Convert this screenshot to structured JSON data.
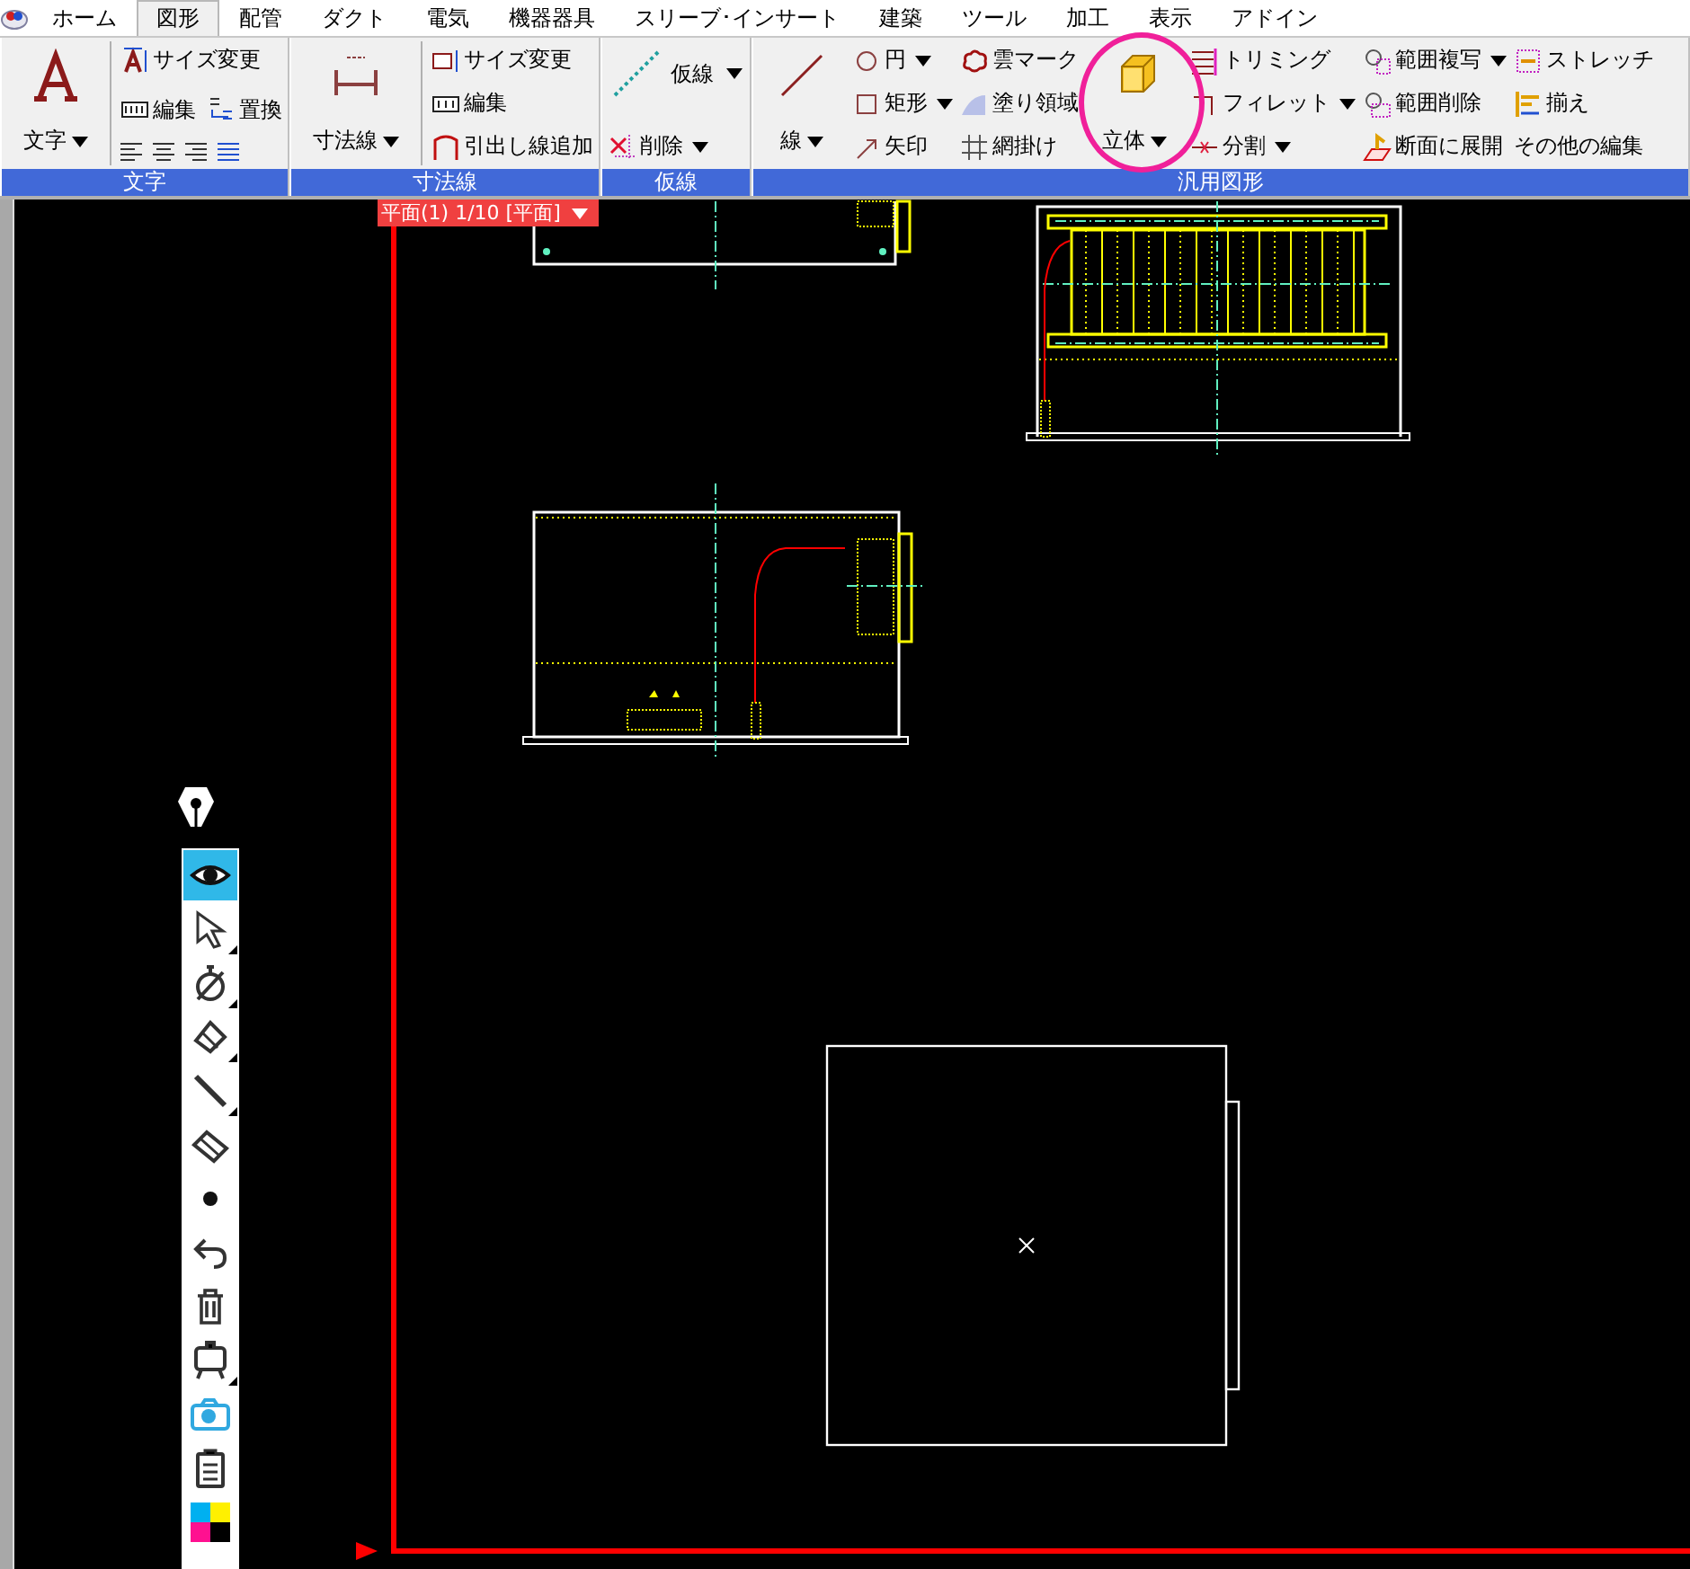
{
  "menu_tabs": [
    {
      "label": "ホーム",
      "selected": false
    },
    {
      "label": "図形",
      "selected": true
    },
    {
      "label": "配管",
      "selected": false
    },
    {
      "label": "ダクト",
      "selected": false
    },
    {
      "label": "電気",
      "selected": false
    },
    {
      "label": "機器器具",
      "selected": false
    },
    {
      "label": "スリーブ･インサート",
      "selected": false
    },
    {
      "label": "建築",
      "selected": false
    },
    {
      "label": "ツール",
      "selected": false
    },
    {
      "label": "加工",
      "selected": false
    },
    {
      "label": "表示",
      "selected": false
    },
    {
      "label": "アドイン",
      "selected": false
    }
  ],
  "ribbon_groups": [
    {
      "title": "文字",
      "columns": [
        [
          [
            {
              "kind": "large",
              "label": "文字",
              "dropdown": true
            }
          ]
        ],
        [
          [
            {
              "kind": "small",
              "label": "サイズ変更",
              "dropdown": false
            }
          ],
          [
            {
              "kind": "small",
              "label": "編集",
              "dropdown": false
            },
            {
              "kind": "small",
              "label": "置換",
              "dropdown": false
            }
          ],
          [
            {
              "kind": "align"
            }
          ]
        ]
      ]
    },
    {
      "title": "寸法線",
      "columns": [
        [
          [
            {
              "kind": "large",
              "label": "寸法線",
              "dropdown": true
            }
          ]
        ],
        [
          [
            {
              "kind": "small",
              "label": "サイズ変更",
              "dropdown": false
            }
          ],
          [
            {
              "kind": "small",
              "label": "編集",
              "dropdown": false
            }
          ],
          [
            {
              "kind": "small",
              "label": "引出し線追加",
              "dropdown": false
            }
          ]
        ]
      ]
    },
    {
      "title": "仮線",
      "columns": [
        [
          [
            {
              "kind": "wide",
              "label": "仮線",
              "dropdown": true
            }
          ],
          [
            {
              "kind": "small",
              "label": "削除",
              "dropdown": true
            }
          ]
        ]
      ]
    },
    {
      "title": "汎用図形",
      "columns": [
        [
          [
            {
              "kind": "large",
              "label": "線",
              "dropdown": true
            }
          ]
        ],
        [
          [
            {
              "kind": "small",
              "label": "円",
              "dropdown": true
            }
          ],
          [
            {
              "kind": "small",
              "label": "矩形",
              "dropdown": true
            }
          ],
          [
            {
              "kind": "small",
              "label": "矢印",
              "dropdown": false
            }
          ]
        ],
        [
          [
            {
              "kind": "small",
              "label": "雲マーク",
              "dropdown": false
            }
          ],
          [
            {
              "kind": "small",
              "label": "塗り領域",
              "dropdown": false
            }
          ],
          [
            {
              "kind": "small",
              "label": "網掛け",
              "dropdown": false
            }
          ]
        ],
        [
          [
            {
              "kind": "large",
              "label": "立体",
              "dropdown": true,
              "highlighted": true
            }
          ]
        ],
        [
          [
            {
              "kind": "small",
              "label": "トリミング",
              "dropdown": false
            }
          ],
          [
            {
              "kind": "small",
              "label": "フィレット",
              "dropdown": true
            }
          ],
          [
            {
              "kind": "small",
              "label": "分割",
              "dropdown": true
            }
          ]
        ],
        [
          [
            {
              "kind": "small",
              "label": "範囲複写",
              "dropdown": true
            }
          ],
          [
            {
              "kind": "small",
              "label": "範囲削除",
              "dropdown": false
            }
          ],
          [
            {
              "kind": "small",
              "label": "断面に展開",
              "dropdown": false
            }
          ]
        ],
        [
          [
            {
              "kind": "small",
              "label": "ストレッチ",
              "dropdown": false
            }
          ],
          [
            {
              "kind": "small",
              "label": "揃え",
              "dropdown": false
            }
          ],
          [
            {
              "kind": "text",
              "label": "その他の編集",
              "dropdown": false
            }
          ]
        ]
      ]
    }
  ],
  "view_tab": {
    "label": "平面(1) 1/10 [平面]"
  },
  "pen_tools": [
    {
      "kind": "eye",
      "selected": true,
      "submenu": false
    },
    {
      "kind": "pointer",
      "selected": false,
      "submenu": true
    },
    {
      "kind": "timer",
      "selected": false,
      "submenu": true
    },
    {
      "kind": "marker",
      "selected": false,
      "submenu": true
    },
    {
      "kind": "line",
      "selected": false,
      "submenu": true
    },
    {
      "kind": "eraser",
      "selected": false,
      "submenu": false
    },
    {
      "kind": "dot",
      "selected": false,
      "submenu": false
    },
    {
      "kind": "undo",
      "selected": false,
      "submenu": false
    },
    {
      "kind": "trash",
      "selected": false,
      "submenu": false
    },
    {
      "kind": "easel",
      "selected": false,
      "submenu": true
    },
    {
      "kind": "camera",
      "selected": false,
      "submenu": false
    },
    {
      "kind": "clipboard",
      "selected": false,
      "submenu": false
    },
    {
      "kind": "palette",
      "selected": false,
      "submenu": false
    }
  ]
}
